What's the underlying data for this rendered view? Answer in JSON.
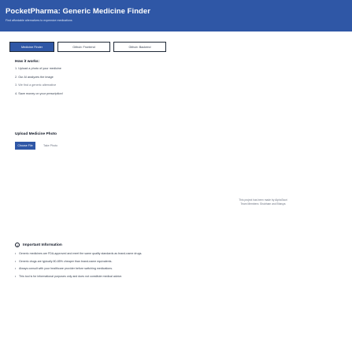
{
  "header": {
    "title": "PocketPharma: Generic Medicine Finder",
    "subtitle": "Find affordable alternatives to expensive medications"
  },
  "tabs": [
    {
      "label": "Medicine Finder",
      "active": true
    },
    {
      "label": "Github: Frontend",
      "active": false
    },
    {
      "label": "Github: Backend",
      "active": false
    }
  ],
  "howto": {
    "title": "How it works:",
    "steps": [
      "1. Upload a photo of your medicine",
      "2. Our AI analyzes the image",
      "3. We find a generic alternative",
      "4. Save money on your prescription!"
    ]
  },
  "upload": {
    "title": "Upload Medicine Photo",
    "button_label": "Choose File",
    "hint": "Take Photo"
  },
  "credit": {
    "line1": "This project has been made by AlphaTauri",
    "line2": "Team Members: Shubham and Bhavya"
  },
  "info": {
    "icon": "info-circle-icon",
    "title": "Important Information",
    "items": [
      "Generic medicines are FDA-approved and meet the same quality standards as brand-name drugs.",
      "Generic drugs are typically 80-85% cheaper than brand-name equivalents.",
      "Always consult with your healthcare provider before switching medications.",
      "This tool is for informational purposes only and does not constitute medical advice."
    ]
  },
  "colors": {
    "brand": "#2f57a6",
    "background": "#ffffff",
    "text": "#1f2937"
  }
}
